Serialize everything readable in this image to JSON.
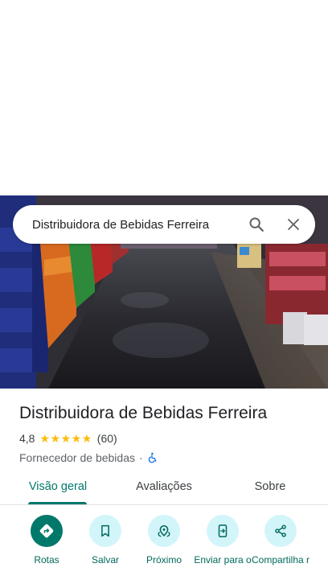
{
  "search": {
    "query": "Distribuidora de Bebidas Ferreira",
    "search_icon": "search-icon",
    "close_icon": "close-icon"
  },
  "place": {
    "title": "Distribuidora de Bebidas Ferreira",
    "rating": "4,8",
    "stars": 5,
    "review_count": "(60)",
    "category": "Fornecedor de bebidas",
    "separator": "·",
    "accessibility_icon": "wheelchair-icon"
  },
  "tabs": [
    {
      "label": "Visão geral",
      "active": true
    },
    {
      "label": "Avaliações",
      "active": false
    },
    {
      "label": "Sobre",
      "active": false
    }
  ],
  "actions": [
    {
      "label": "Rotas",
      "icon": "directions-icon"
    },
    {
      "label": "Salvar",
      "icon": "bookmark-icon"
    },
    {
      "label": "Próximo",
      "icon": "nearby-icon"
    },
    {
      "label": "Enviar para o",
      "icon": "send-to-phone-icon"
    },
    {
      "label": "Compartilha r",
      "icon": "share-icon"
    }
  ],
  "colors": {
    "accent": "#00796b",
    "action_bg": "#d2f5fa",
    "star": "#fbbc04"
  }
}
